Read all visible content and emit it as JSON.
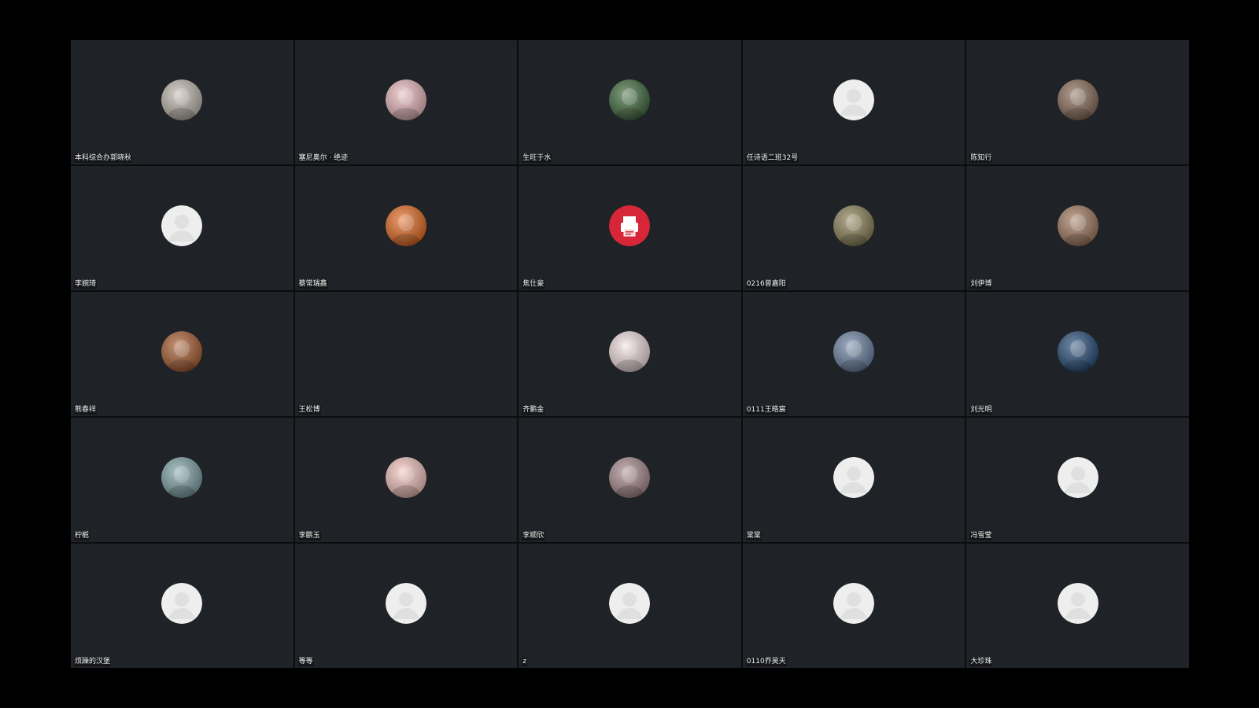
{
  "participants": [
    {
      "name": "本科综合办郭晓秋",
      "avatar": "cat-photo",
      "color": "#bfb6ad"
    },
    {
      "name": "塞尼奥尔 · 绝迹",
      "avatar": "anime-girl-pink",
      "color": "#e9b7bc"
    },
    {
      "name": "生旺于水",
      "avatar": "person-forest-photo",
      "color": "#3f6a3c"
    },
    {
      "name": "任诗语二班32号",
      "avatar": "default-user-icon",
      "color": "#e8e8e8"
    },
    {
      "name": "陈知行",
      "avatar": "person-portrait-photo",
      "color": "#8a6c58"
    },
    {
      "name": "李婉琦",
      "avatar": "default-user-icon",
      "color": "#e8e8e8"
    },
    {
      "name": "蔡常瑞鑫",
      "avatar": "anime-girl-orange",
      "color": "#e46a20"
    },
    {
      "name": "焦仕豪",
      "avatar": "red-printer-icon",
      "color": "#d72638"
    },
    {
      "name": "0216曾嘉阳",
      "avatar": "rainbow-scene-photo",
      "color": "#8a8055"
    },
    {
      "name": "刘伊博",
      "avatar": "animal-photo",
      "color": "#a1785e"
    },
    {
      "name": "熊春祥",
      "avatar": "sunset-sky-photo",
      "color": "#a85b2e"
    },
    {
      "name": "王松博",
      "avatar": "",
      "color": ""
    },
    {
      "name": "齐鹏金",
      "avatar": "anime-boy-sketch",
      "color": "#f0dede"
    },
    {
      "name": "0111王皓宸",
      "avatar": "person-blue-photo",
      "color": "#6b82a3"
    },
    {
      "name": "刘光明",
      "avatar": "moon-night-photo",
      "color": "#244c7a"
    },
    {
      "name": "柠栀",
      "avatar": "child-photo",
      "color": "#7ea1a5"
    },
    {
      "name": "李鹏玉",
      "avatar": "anime-girl-green-eyes",
      "color": "#f3c2bc"
    },
    {
      "name": "李顺欣",
      "avatar": "anime-girl-dark-hair",
      "color": "#a8898e"
    },
    {
      "name": "棠棠",
      "avatar": "default-user-icon",
      "color": "#e8e8e8"
    },
    {
      "name": "冯雪莹",
      "avatar": "default-user-icon",
      "color": "#e8e8e8"
    },
    {
      "name": "烦躁的汉堡",
      "avatar": "default-user-icon",
      "color": "#e8e8e8"
    },
    {
      "name": "等等",
      "avatar": "default-user-icon",
      "color": "#e8e8e8"
    },
    {
      "name": "z",
      "avatar": "default-user-icon",
      "color": "#e8e8e8"
    },
    {
      "name": "0110乔昊天",
      "avatar": "default-user-icon",
      "color": "#e8e8e8"
    },
    {
      "name": "大珍珠",
      "avatar": "default-user-icon",
      "color": "#e8e8e8"
    }
  ],
  "colors": {
    "background": "#000000",
    "tile": "#1f2226",
    "name_text": "#f2f2f2"
  }
}
